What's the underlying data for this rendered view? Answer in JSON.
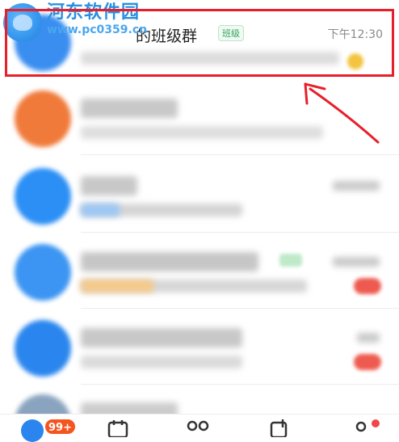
{
  "watermark": {
    "site_name": "河东软件园",
    "url": "www.pc0359.cn"
  },
  "highlighted_chat": {
    "name": "的班级群",
    "tag": "班级",
    "time": "下午12:30"
  },
  "tabbar": {
    "unread_badge": "99+"
  },
  "colors": {
    "highlight_border": "#e81f2a",
    "badge_red": "#f5541e",
    "brand_blue": "#2a8fe0"
  }
}
